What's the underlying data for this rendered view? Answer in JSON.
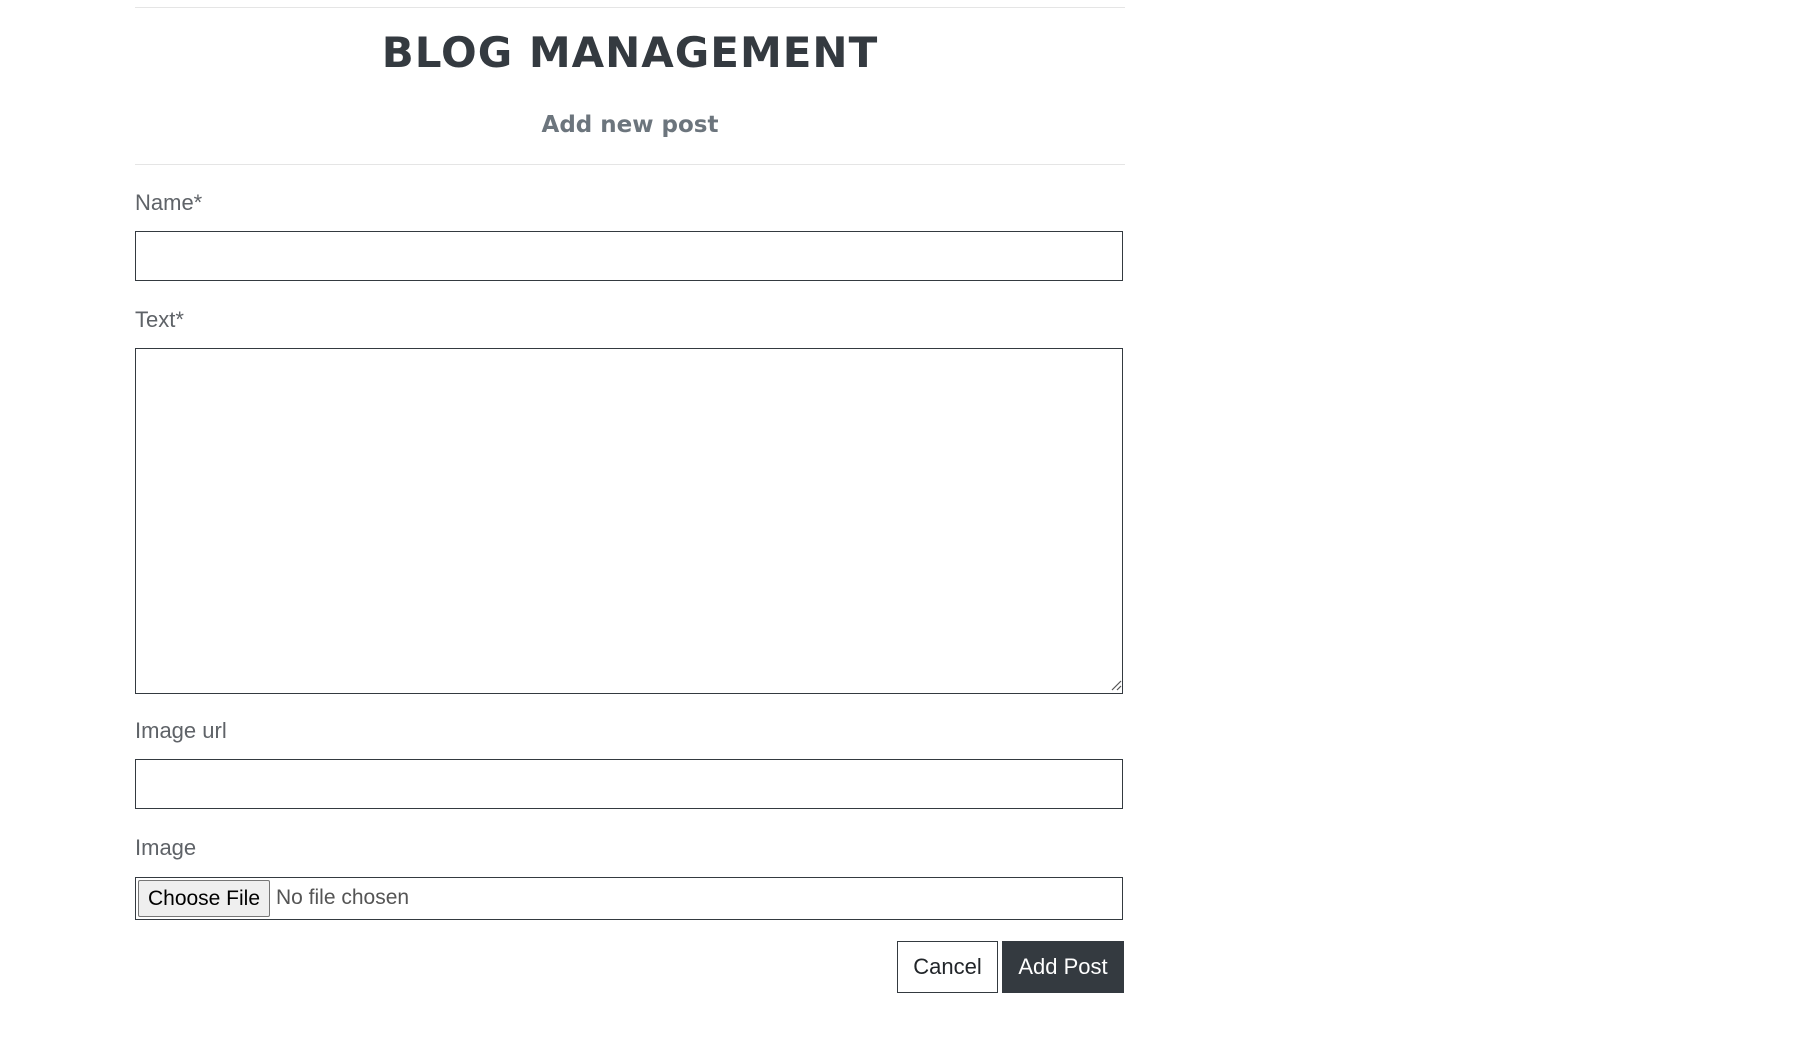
{
  "header": {
    "title": "BLOG MANAGEMENT",
    "subtitle": "Add new post"
  },
  "form": {
    "name": {
      "label": "Name*",
      "value": ""
    },
    "text": {
      "label": "Text*",
      "value": ""
    },
    "image_url": {
      "label": "Image url",
      "value": ""
    },
    "image": {
      "label": "Image",
      "choose_button": "Choose File",
      "status": "No file chosen"
    }
  },
  "actions": {
    "cancel_label": "Cancel",
    "submit_label": "Add Post"
  },
  "colors": {
    "dark": "#343a40",
    "muted": "#6c757d",
    "label": "#5f6368"
  },
  "icons": {
    "resize_grip": "textarea-resize-grip-icon"
  }
}
